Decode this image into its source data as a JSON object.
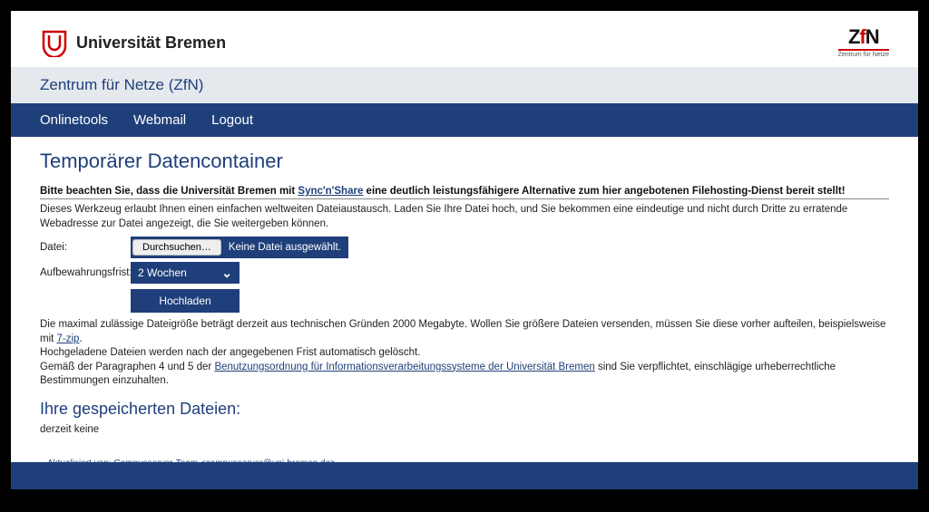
{
  "header": {
    "uni_name": "Universität Bremen",
    "zfn_sub": "Zentrum für Netze"
  },
  "subheader": "Zentrum für Netze (ZfN)",
  "nav": {
    "onlinetools": "Onlinetools",
    "webmail": "Webmail",
    "logout": "Logout"
  },
  "page": {
    "title": "Temporärer Datencontainer",
    "notice_pre": "Bitte beachten Sie, dass die Universität Bremen mit ",
    "notice_link": "Sync'n'Share",
    "notice_post": " eine deutlich leistungsfähigere Alternative zum hier angebotenen Filehosting-Dienst bereit stellt!",
    "desc": "Dieses Werkzeug erlaubt Ihnen einen einfachen weltweiten Dateiaustausch. Laden Sie Ihre Datei hoch, und Sie bekommen eine eindeutige und nicht durch Dritte zu erratende Webadresse zur Datei angezeigt, die Sie weitergeben können.",
    "file_label": "Datei:",
    "browse": "Durchsuchen…",
    "file_status": "Keine Datei ausgewählt.",
    "retention_label": "Aufbewahrungsfrist:",
    "retention_value": "2 Wochen",
    "upload": "Hochladen",
    "info_1a": "Die maximal zulässige Dateigröße beträgt derzeit aus technischen Gründen 2000 Megabyte. Wollen Sie größere Dateien versenden, müssen Sie diese vorher aufteilen, beispielsweise mit ",
    "info_1_link": "7-zip",
    "info_1b": ".",
    "info_2": "Hochgeladene Dateien werden nach der angegebenen Frist automatisch gelöscht.",
    "info_3a": "Gemäß der Paragraphen 4 und 5 der ",
    "info_3_link": "Benutzungsordnung für Informationsverarbeitungssysteme der Universität Bremen",
    "info_3b": " sind Sie verpflichtet, einschlägige urheberrechtliche Bestimmungen einzuhalten.",
    "stored_title": "Ihre gespeicherten Dateien:",
    "stored_empty": "derzeit keine",
    "updated_by": "Aktualisiert von: Campusserver-Team <campusserver@uni-bremen.de>"
  }
}
